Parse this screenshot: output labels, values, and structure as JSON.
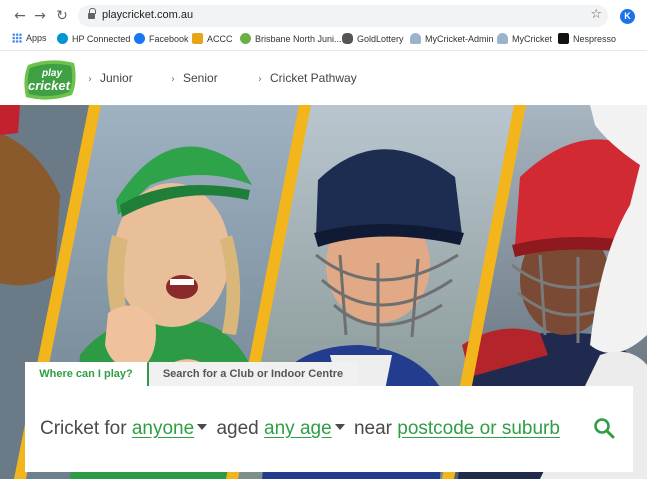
{
  "browser": {
    "url": "playcricket.com.au",
    "profile_initial": "K",
    "bookmarks": [
      {
        "label": "Apps",
        "icon": "apps-grid-icon"
      },
      {
        "label": "HP Connected",
        "icon": "hp-icon"
      },
      {
        "label": "Facebook",
        "icon": "facebook-icon"
      },
      {
        "label": "ACCC",
        "icon": "accc-icon"
      },
      {
        "label": "Brisbane North Juni...",
        "icon": "club-icon"
      },
      {
        "label": "GoldLottery",
        "icon": "lottery-icon"
      },
      {
        "label": "MyCricket-Admin",
        "icon": "mycricket-icon"
      },
      {
        "label": "MyCricket",
        "icon": "mycricket-icon"
      },
      {
        "label": "Nespresso",
        "icon": "nespresso-icon"
      }
    ]
  },
  "site": {
    "logo_text_top": "play",
    "logo_text_bottom": "cricket",
    "nav": [
      {
        "label": "Junior"
      },
      {
        "label": "Senior"
      },
      {
        "label": "Cricket Pathway"
      }
    ]
  },
  "search": {
    "tabs": [
      {
        "label": "Where can I play?",
        "active": true
      },
      {
        "label": "Search for a Club or Indoor Centre",
        "active": false
      }
    ],
    "prefix": "Cricket for",
    "who": "anyone",
    "aged_word": "aged",
    "age": "any age",
    "near_word": "near",
    "location": "postcode or suburb"
  },
  "colors": {
    "brand_green": "#2f9e44",
    "stripe_yellow": "#f2b61c"
  }
}
